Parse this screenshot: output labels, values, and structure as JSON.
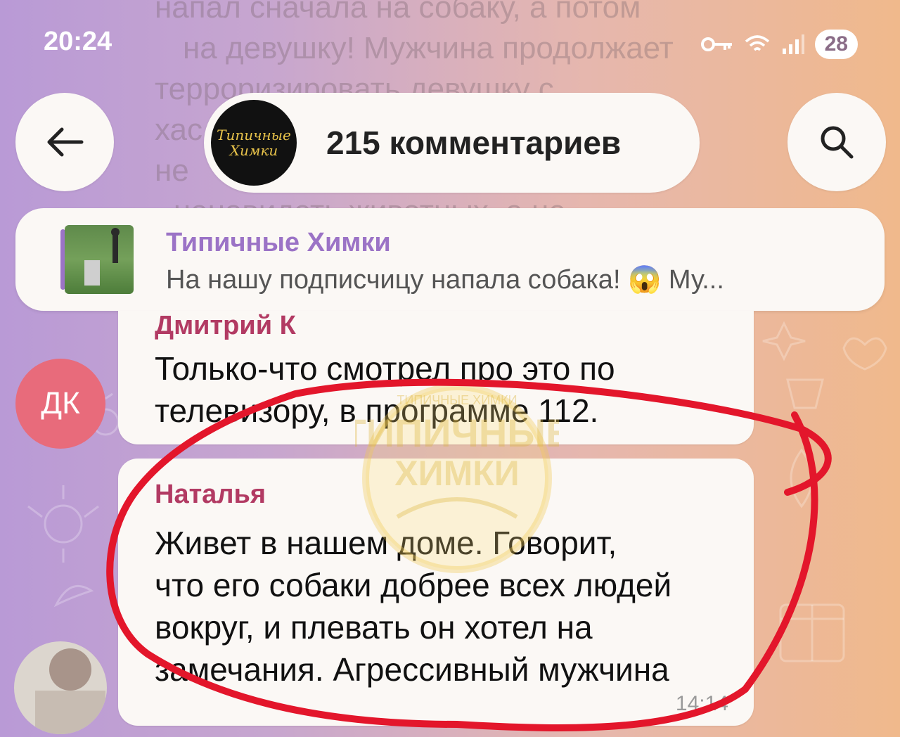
{
  "status_bar": {
    "time": "20:24",
    "battery": "28"
  },
  "background_text": [
    "напал сначала на собаку, а потом",
    "на девушку! Мужчина продолжает",
    "терроризировать девушку с",
    "хас",
    "не",
    "- ненавидеть животных, а не"
  ],
  "header": {
    "title": "215 комментариев",
    "logo_text": [
      "Типичные",
      "Химки"
    ]
  },
  "pinned": {
    "channel": "Типичные Химки",
    "preview": "На нашу подписчицу напала собака! 😱 Му..."
  },
  "comments": [
    {
      "avatar_initials": "ДК",
      "sender": "Дмитрий К",
      "lines": [
        "Только-что смотрел про это по",
        "телевизору, в программе 112."
      ],
      "time": ""
    },
    {
      "sender": "Наталья",
      "lines": [
        "Живет в нашем доме. Говорит,",
        "что его собаки добрее всех людей",
        "вокруг, и плевать он хотел на",
        "замечания. Агрессивный мужчина"
      ],
      "time": "14:14"
    }
  ],
  "watermark": {
    "line1": "ТИПИЧНЫЕ",
    "line2": "ХИМКИ",
    "arc": "ТИПИЧНЫЕ ХИМКИ"
  },
  "colors": {
    "accent": "#9b73c6",
    "sender": "#b23a63",
    "annotation": "#e3162b"
  }
}
